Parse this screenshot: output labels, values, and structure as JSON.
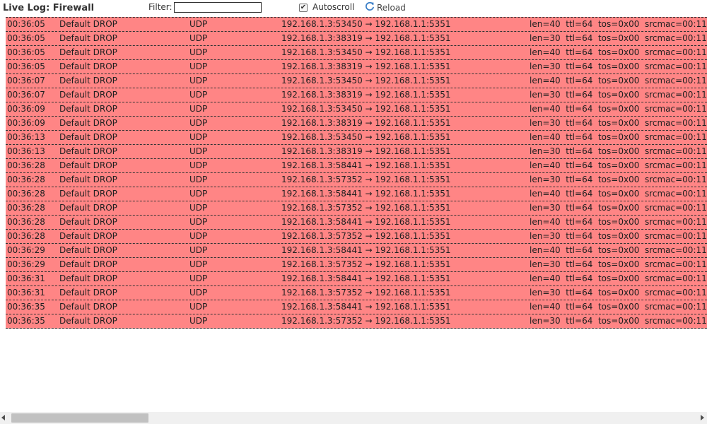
{
  "toolbar": {
    "title": "Live Log: Firewall",
    "filter_label": "Filter:",
    "filter_value": "",
    "autoscroll_label": "Autoscroll",
    "autoscroll_checked": true,
    "reload_label": "Reload"
  },
  "colors": {
    "drop_row": "#ff8585",
    "reload_icon": "#3a7ec7"
  },
  "log": {
    "rows": [
      {
        "time": "00:36:05",
        "rule": "Default DROP",
        "proto": "UDP",
        "conn": "192.168.1.3:53450 → 192.168.1.1:5351",
        "info": "len=40  ttl=64  tos=0x00  srcmac=00:11"
      },
      {
        "time": "00:36:05",
        "rule": "Default DROP",
        "proto": "UDP",
        "conn": "192.168.1.3:38319 → 192.168.1.1:5351",
        "info": "len=30  ttl=64  tos=0x00  srcmac=00:11"
      },
      {
        "time": "00:36:05",
        "rule": "Default DROP",
        "proto": "UDP",
        "conn": "192.168.1.3:53450 → 192.168.1.1:5351",
        "info": "len=40  ttl=64  tos=0x00  srcmac=00:11"
      },
      {
        "time": "00:36:05",
        "rule": "Default DROP",
        "proto": "UDP",
        "conn": "192.168.1.3:38319 → 192.168.1.1:5351",
        "info": "len=30  ttl=64  tos=0x00  srcmac=00:11"
      },
      {
        "time": "00:36:07",
        "rule": "Default DROP",
        "proto": "UDP",
        "conn": "192.168.1.3:53450 → 192.168.1.1:5351",
        "info": "len=40  ttl=64  tos=0x00  srcmac=00:11"
      },
      {
        "time": "00:36:07",
        "rule": "Default DROP",
        "proto": "UDP",
        "conn": "192.168.1.3:38319 → 192.168.1.1:5351",
        "info": "len=30  ttl=64  tos=0x00  srcmac=00:11"
      },
      {
        "time": "00:36:09",
        "rule": "Default DROP",
        "proto": "UDP",
        "conn": "192.168.1.3:53450 → 192.168.1.1:5351",
        "info": "len=40  ttl=64  tos=0x00  srcmac=00:11"
      },
      {
        "time": "00:36:09",
        "rule": "Default DROP",
        "proto": "UDP",
        "conn": "192.168.1.3:38319 → 192.168.1.1:5351",
        "info": "len=30  ttl=64  tos=0x00  srcmac=00:11"
      },
      {
        "time": "00:36:13",
        "rule": "Default DROP",
        "proto": "UDP",
        "conn": "192.168.1.3:53450 → 192.168.1.1:5351",
        "info": "len=40  ttl=64  tos=0x00  srcmac=00:11"
      },
      {
        "time": "00:36:13",
        "rule": "Default DROP",
        "proto": "UDP",
        "conn": "192.168.1.3:38319 → 192.168.1.1:5351",
        "info": "len=30  ttl=64  tos=0x00  srcmac=00:11"
      },
      {
        "time": "00:36:28",
        "rule": "Default DROP",
        "proto": "UDP",
        "conn": "192.168.1.3:58441 → 192.168.1.1:5351",
        "info": "len=40  ttl=64  tos=0x00  srcmac=00:11"
      },
      {
        "time": "00:36:28",
        "rule": "Default DROP",
        "proto": "UDP",
        "conn": "192.168.1.3:57352 → 192.168.1.1:5351",
        "info": "len=30  ttl=64  tos=0x00  srcmac=00:11"
      },
      {
        "time": "00:36:28",
        "rule": "Default DROP",
        "proto": "UDP",
        "conn": "192.168.1.3:58441 → 192.168.1.1:5351",
        "info": "len=40  ttl=64  tos=0x00  srcmac=00:11"
      },
      {
        "time": "00:36:28",
        "rule": "Default DROP",
        "proto": "UDP",
        "conn": "192.168.1.3:57352 → 192.168.1.1:5351",
        "info": "len=30  ttl=64  tos=0x00  srcmac=00:11"
      },
      {
        "time": "00:36:28",
        "rule": "Default DROP",
        "proto": "UDP",
        "conn": "192.168.1.3:58441 → 192.168.1.1:5351",
        "info": "len=40  ttl=64  tos=0x00  srcmac=00:11"
      },
      {
        "time": "00:36:28",
        "rule": "Default DROP",
        "proto": "UDP",
        "conn": "192.168.1.3:57352 → 192.168.1.1:5351",
        "info": "len=30  ttl=64  tos=0x00  srcmac=00:11"
      },
      {
        "time": "00:36:29",
        "rule": "Default DROP",
        "proto": "UDP",
        "conn": "192.168.1.3:58441 → 192.168.1.1:5351",
        "info": "len=40  ttl=64  tos=0x00  srcmac=00:11"
      },
      {
        "time": "00:36:29",
        "rule": "Default DROP",
        "proto": "UDP",
        "conn": "192.168.1.3:57352 → 192.168.1.1:5351",
        "info": "len=30  ttl=64  tos=0x00  srcmac=00:11"
      },
      {
        "time": "00:36:31",
        "rule": "Default DROP",
        "proto": "UDP",
        "conn": "192.168.1.3:58441 → 192.168.1.1:5351",
        "info": "len=40  ttl=64  tos=0x00  srcmac=00:11"
      },
      {
        "time": "00:36:31",
        "rule": "Default DROP",
        "proto": "UDP",
        "conn": "192.168.1.3:57352 → 192.168.1.1:5351",
        "info": "len=30  ttl=64  tos=0x00  srcmac=00:11"
      },
      {
        "time": "00:36:35",
        "rule": "Default DROP",
        "proto": "UDP",
        "conn": "192.168.1.3:58441 → 192.168.1.1:5351",
        "info": "len=40  ttl=64  tos=0x00  srcmac=00:11"
      },
      {
        "time": "00:36:35",
        "rule": "Default DROP",
        "proto": "UDP",
        "conn": "192.168.1.3:57352 → 192.168.1.1:5351",
        "info": "len=30  ttl=64  tos=0x00  srcmac=00:11"
      }
    ]
  }
}
